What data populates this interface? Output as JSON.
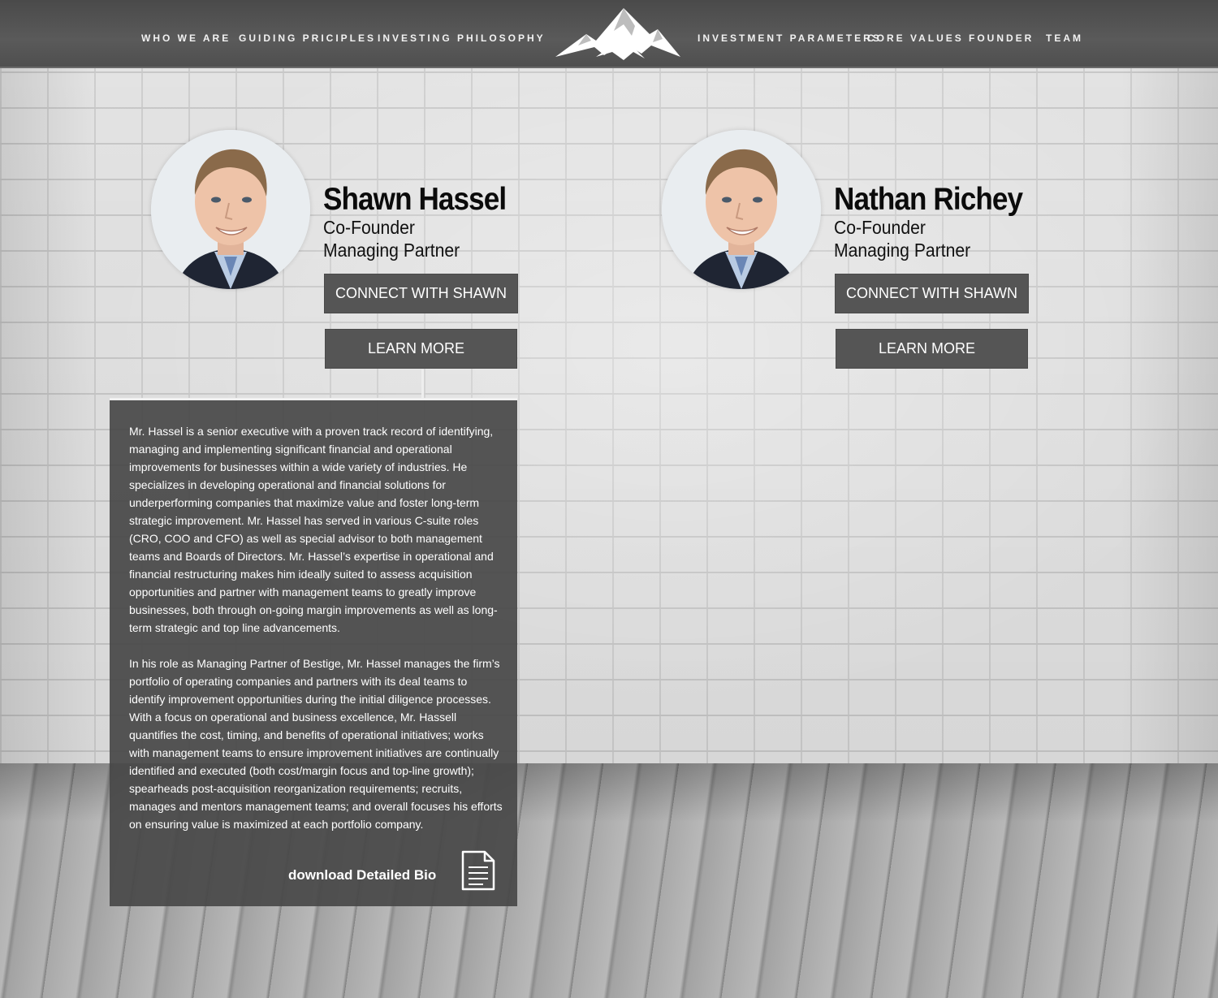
{
  "nav": {
    "items": [
      {
        "label": "WHO WE ARE"
      },
      {
        "label": "GUIDING PRICIPLES"
      },
      {
        "label": "INVESTING PHILOSOPHY"
      },
      {
        "label": "INVESTMENT PARAMETERS"
      },
      {
        "label": "CORE VALUES"
      },
      {
        "label": "FOUNDER"
      },
      {
        "label": "TEAM"
      }
    ],
    "logo_icon": "mountain-logo-icon"
  },
  "people": [
    {
      "name": "Shawn Hassel",
      "role_line1": "Co-Founder",
      "role_line2": "Managing Partner",
      "connect_label": "CONNECT WITH SHAWN",
      "learn_label": "LEARN MORE"
    },
    {
      "name": "Nathan Richey",
      "role_line1": "Co-Founder",
      "role_line2": "Managing Partner",
      "connect_label": "CONNECT WITH SHAWN",
      "learn_label": "LEARN MORE"
    }
  ],
  "bio": {
    "paragraphs": [
      "Mr. Hassel is a senior executive with a proven track record of identifying, managing and implementing significant financial and operational improvements for businesses within a wide variety of industries. He specializes in developing operational and financial solutions for underperforming companies that maximize value and foster long-term strategic improvement.  Mr. Hassel has served in various C-suite roles (CRO, COO and CFO) as well as special advisor to both management teams and Boards of Directors.  Mr. Hassel’s expertise in operational and financial restructuring makes him ideally suited to assess acquisition opportunities and partner with management teams to greatly improve businesses, both through on-going margin improvements as well as long-term strategic and top line advancements.",
      "In his role as Managing Partner of Bestige, Mr. Hassel manages the firm’s portfolio of operating companies and partners with its deal teams to identify improvement opportunities during the initial diligence processes. With a focus on operational and business excellence, Mr. Hassell quantifies the cost, timing, and benefits of operational initiatives; works with management teams to ensure improvement initiatives are continually identified and executed (both cost/margin focus and top-line growth); spearheads post-acquisition reorganization requirements; recruits, manages and mentors management teams; and overall focuses his efforts on ensuring value is maximized at each portfolio company."
    ],
    "download_label": "download Detailed Bio",
    "download_icon": "document-icon"
  },
  "colors": {
    "nav_bg": "#525252",
    "button_bg": "#555555",
    "panel_bg": "#484848",
    "text_light": "#ffffff",
    "text_dark": "#0b0b0b"
  }
}
